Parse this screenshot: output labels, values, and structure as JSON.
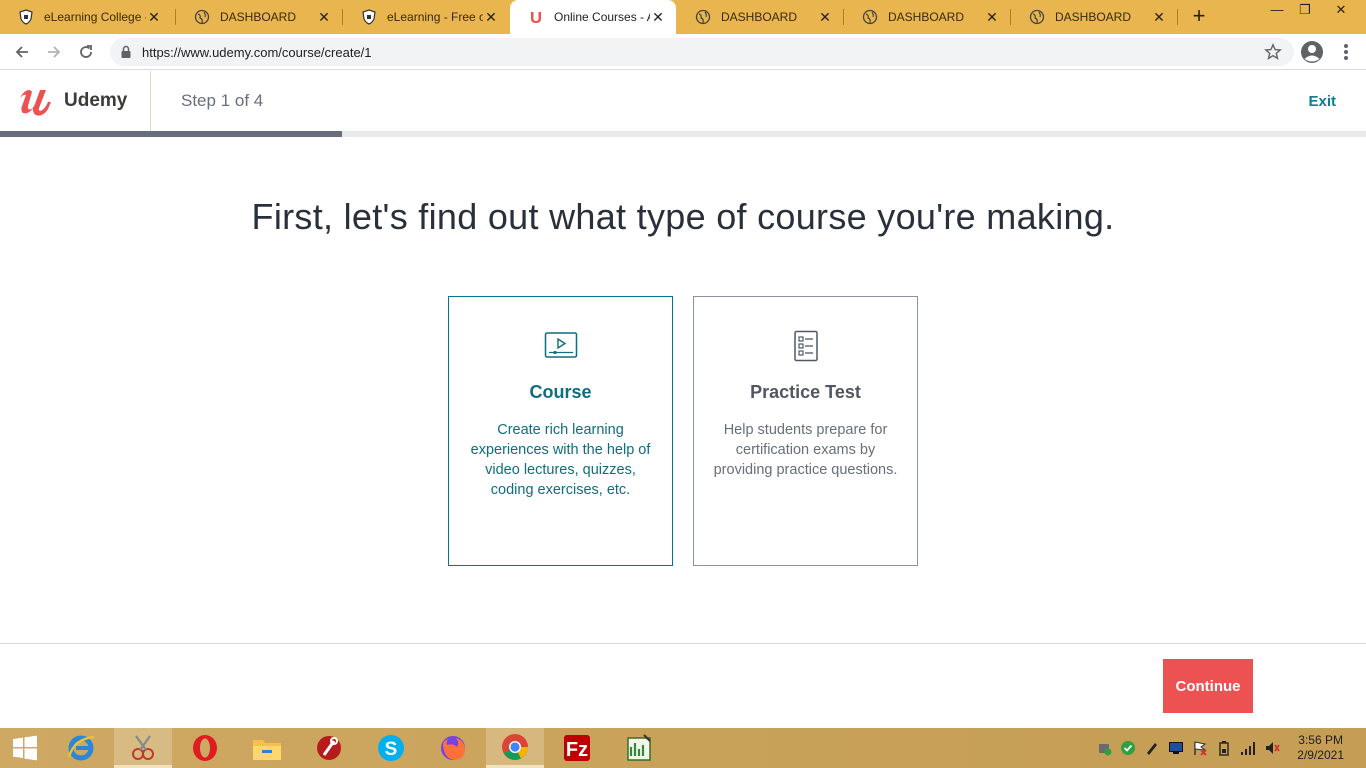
{
  "browser": {
    "tabs": [
      {
        "title": "eLearning College -",
        "favicon": "elearning-shield-icon",
        "active": false
      },
      {
        "title": "DASHBOARD",
        "favicon": "globe-icon",
        "active": false
      },
      {
        "title": "eLearning - Free on",
        "favicon": "elearning-shield-icon",
        "active": false
      },
      {
        "title": "Online Courses - A",
        "favicon": "udemy-icon",
        "active": true
      },
      {
        "title": "DASHBOARD",
        "favicon": "globe-icon",
        "active": false
      },
      {
        "title": "DASHBOARD",
        "favicon": "globe-icon",
        "active": false
      },
      {
        "title": "DASHBOARD",
        "favicon": "globe-icon",
        "active": false
      }
    ],
    "url": "https://www.udemy.com/course/create/1"
  },
  "header": {
    "brand": "Udemy",
    "step": "Step 1 of 4",
    "exit": "Exit",
    "progress_fraction": 0.25
  },
  "main": {
    "headline": "First, let's find out what type of course you're making.",
    "cards": [
      {
        "title": "Course",
        "description": "Create rich learning experiences with the help of video lectures, quizzes, coding exercises, etc.",
        "icon": "video-lecture-icon",
        "selected": true
      },
      {
        "title": "Practice Test",
        "description": "Help students prepare for certification exams by providing practice questions.",
        "icon": "checklist-icon",
        "selected": false
      }
    ],
    "continue_label": "Continue"
  },
  "taskbar": {
    "time": "3:56 PM",
    "date": "2/9/2021"
  },
  "colors": {
    "accent": "#0f7c90",
    "continue": "#ec5252",
    "tabstrip": "#e8b54e"
  }
}
